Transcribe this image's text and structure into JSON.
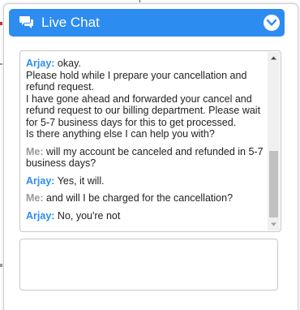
{
  "header": {
    "title": "Live Chat",
    "accent_color": "#2d8cf0",
    "chat_icon": "chat-bubbles-icon",
    "toggle_icon": "chevron-down-circle-icon"
  },
  "transcript": {
    "messages": [
      {
        "speaker": "Arjay:",
        "role": "agent",
        "lines": [
          "okay.",
          "Please hold while I prepare your cancellation and refund request.",
          "I have gone ahead and forwarded your cancel and refund request to our billing department. Please wait for 5-7 business days for this to get processed.",
          "Is there anything else I can help you with?"
        ]
      },
      {
        "speaker": "Me:",
        "role": "user",
        "text": "will my account be canceled and refunded in 5-7 business days?"
      },
      {
        "speaker": "Arjay:",
        "role": "agent",
        "text": "Yes, it will."
      },
      {
        "speaker": "Me:",
        "role": "user",
        "text": "and will I be charged for the cancellation?"
      },
      {
        "speaker": "Arjay:",
        "role": "agent",
        "text": "No, you're not"
      }
    ]
  },
  "message_input": {
    "value": "",
    "placeholder": ""
  }
}
